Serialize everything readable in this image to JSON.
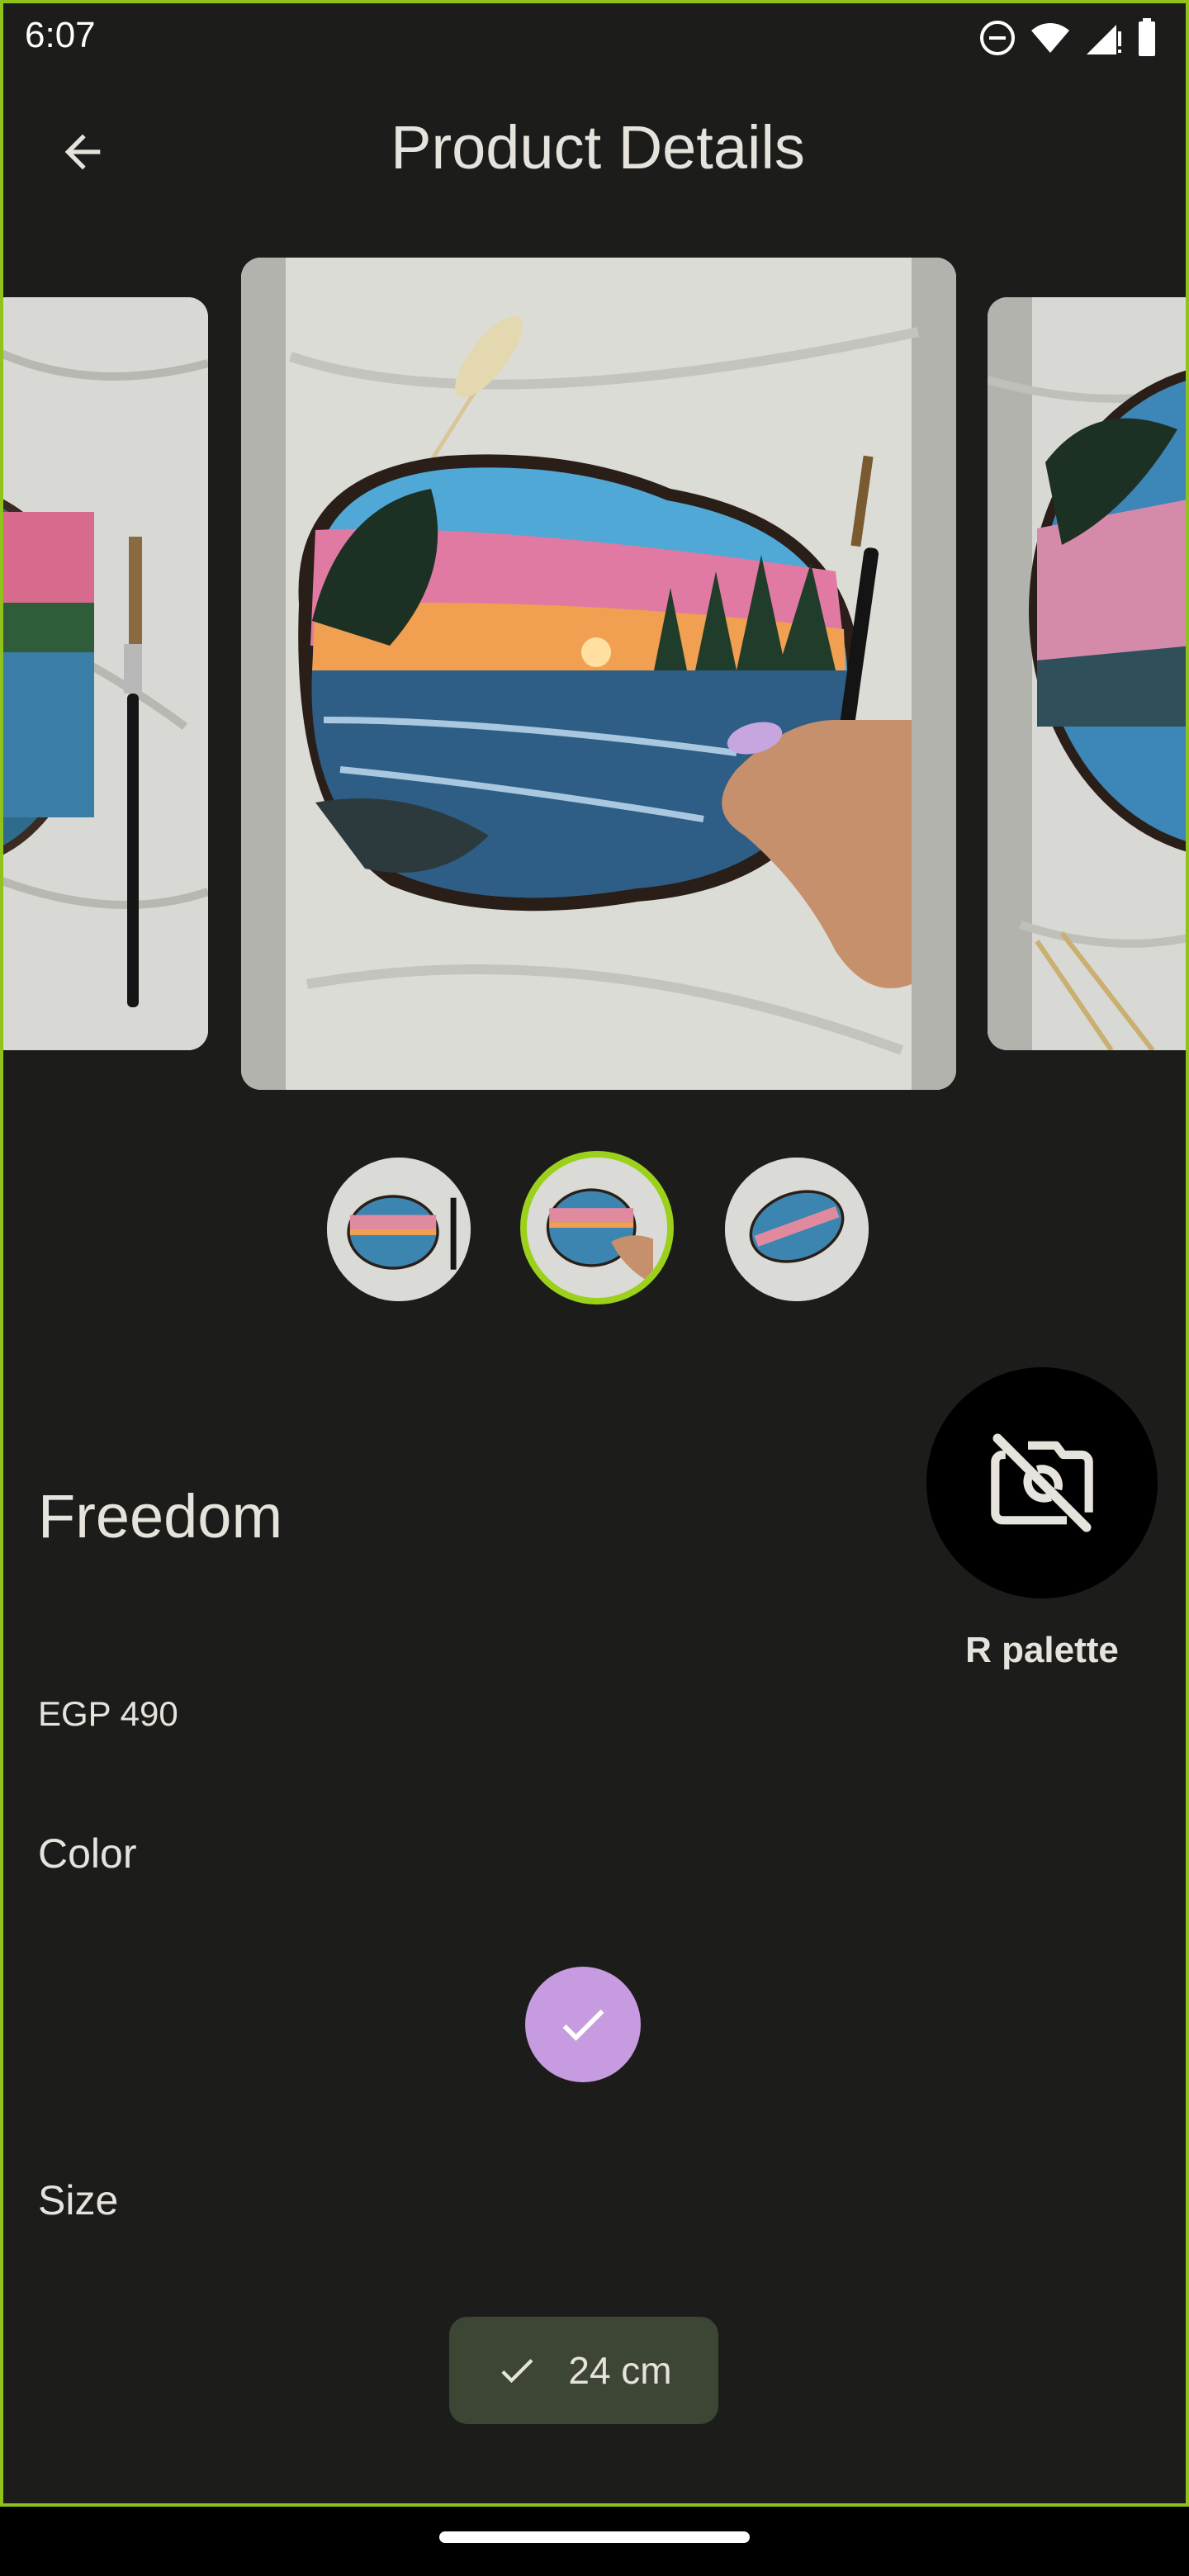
{
  "status_bar": {
    "time": "6:07",
    "icons": [
      "do-not-disturb-icon",
      "wifi-icon",
      "cellular-signal-icon",
      "battery-icon"
    ]
  },
  "app_bar": {
    "title": "Product Details",
    "back_icon": "arrow-back-icon"
  },
  "carousel": {
    "images": [
      "painting-photo-1",
      "painting-photo-2",
      "painting-photo-3"
    ],
    "selected_index": 1
  },
  "product": {
    "name": "Freedom",
    "price": "EGP 490",
    "color_label": "Color",
    "size_label": "Size",
    "selected_color": "#c79be0",
    "selected_size": "24 cm"
  },
  "fab": {
    "icon": "no-photography-icon",
    "label": "R palette"
  },
  "colors": {
    "accent": "#9bd11b",
    "background": "#1c1c1a",
    "chip": "#3d4534"
  }
}
